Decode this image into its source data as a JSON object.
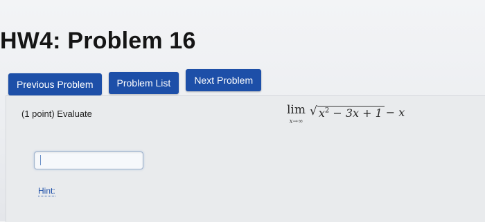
{
  "header": {
    "title": "HW4: Problem 16"
  },
  "nav": {
    "previous_label": "Previous Problem",
    "list_label": "Problem List",
    "next_label": "Next Problem"
  },
  "problem": {
    "points_text": "(1 point) Evaluate",
    "limit_word": "lim",
    "limit_sub": "x→∞",
    "radical_symbol": "√",
    "radicand_x": "x",
    "radicand_exponent": "2",
    "radicand_rest": " − 3x + 1",
    "tail": " − x",
    "answer_value": "",
    "hint_label": "Hint:"
  },
  "colors": {
    "button_bg": "#1d4fa8",
    "link": "#1d4fa8"
  }
}
